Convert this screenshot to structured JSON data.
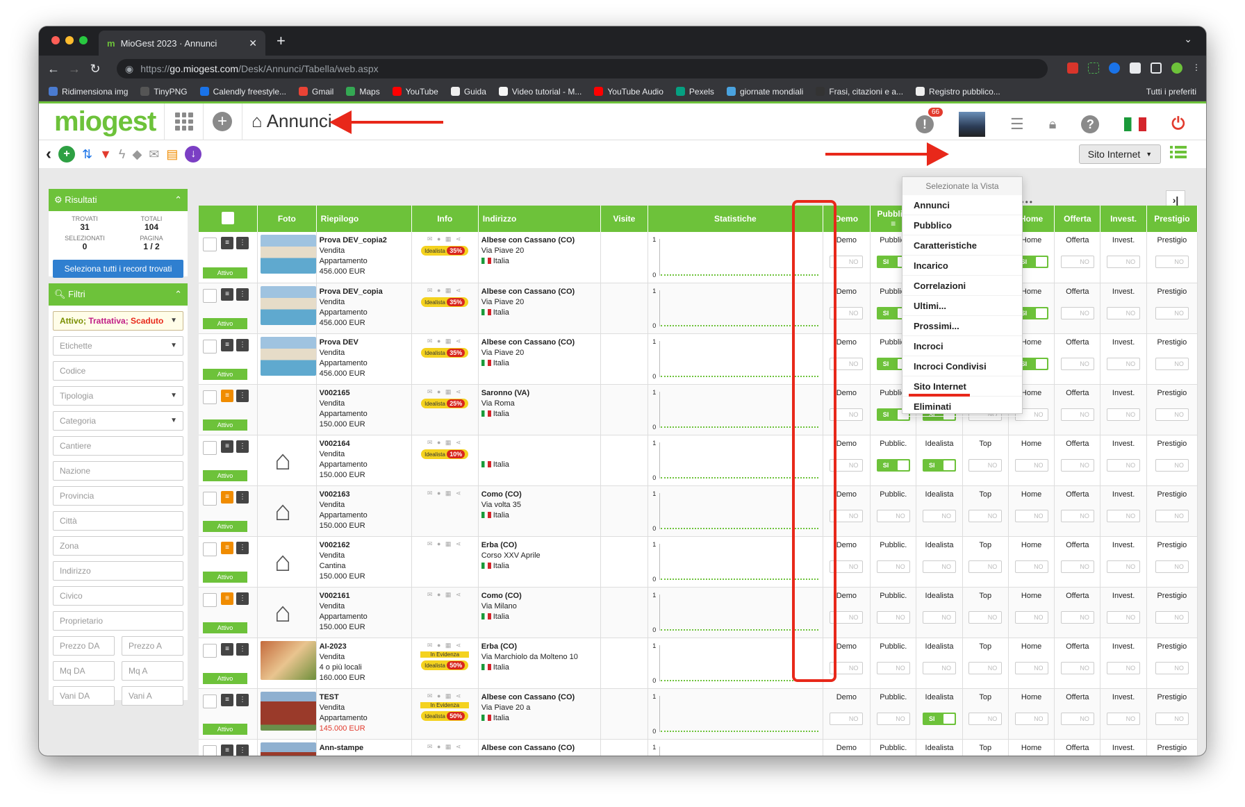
{
  "browser": {
    "tab_title": "MioGest 2023 · Annunci",
    "url_scheme": "https://",
    "url_host": "go.miogest.com",
    "url_path": "/Desk/Annunci/Tabella/web.aspx",
    "bookmarks": [
      "Ridimensiona img",
      "TinyPNG",
      "Calendly freestyle...",
      "Gmail",
      "Maps",
      "YouTube",
      "Guida",
      "Video tutorial - M...",
      "YouTube Audio",
      "Pexels",
      "giornate mondiali",
      "Frasi, citazioni e a...",
      "Registro pubblico..."
    ],
    "bookmarks_all": "Tutti i preferiti"
  },
  "app": {
    "logo": "miogest",
    "page_title": "Annunci",
    "notif_count": "66",
    "view_button": "Sito Internet"
  },
  "results": {
    "title": "Risultati",
    "trovati_label": "TROVATI",
    "trovati": "31",
    "totali_label": "TOTALI",
    "totali": "104",
    "selezionati_label": "SELEZIONATI",
    "selezionati": "0",
    "pagina_label": "PAGINA",
    "pagina": "1 / 2",
    "select_all": "Seleziona tutti i record trovati"
  },
  "filters": {
    "title": "Filtri",
    "status": "Attivo; Trattativa; Scaduto",
    "status_parts": [
      "Attivo;",
      "Trattativa;",
      "Scaduto"
    ],
    "fields": [
      "Etichette",
      "Codice",
      "Tipologia",
      "Categoria",
      "Cantiere",
      "Nazione",
      "Provincia",
      "Città",
      "Zona",
      "Indirizzo",
      "Civico",
      "Proprietario"
    ],
    "pairs": [
      [
        "Prezzo DA",
        "Prezzo A"
      ],
      [
        "Mq DA",
        "Mq A"
      ],
      [
        "Vani DA",
        "Vani A"
      ]
    ]
  },
  "table": {
    "headers": [
      "Foto",
      "Riepilogo",
      "Info",
      "Indirizzo",
      "Visite",
      "Statistiche",
      "Demo",
      "Pubblic.",
      "Idealista",
      "Top",
      "Home",
      "Offerta",
      "Invest.",
      "Prestigio"
    ],
    "cell_labels": [
      "Demo",
      "Pubblic.",
      "Idealista",
      "Top",
      "Home",
      "Offerta",
      "Invest.",
      "Prestigio"
    ],
    "off_text": "NO",
    "on_text": "SI",
    "status_text": "Attivo",
    "rows": [
      {
        "code": "Prova DEV_copia2",
        "l2": "Vendita",
        "l3": "Appartamento",
        "price": "456.000 EUR",
        "photo": "pool",
        "idealista": "Idealista",
        "pct": "35%",
        "evidenza": "",
        "city": "Albese con Cassano (CO)",
        "street": "Via Piave 20",
        "country": "Italia",
        "toggles": [
          0,
          1,
          0,
          0,
          1,
          0,
          0,
          0
        ]
      },
      {
        "code": "Prova DEV_copia",
        "l2": "Vendita",
        "l3": "Appartamento",
        "price": "456.000 EUR",
        "photo": "pool",
        "idealista": "Idealista",
        "pct": "35%",
        "evidenza": "",
        "city": "Albese con Cassano (CO)",
        "street": "Via Piave 20",
        "country": "Italia",
        "toggles": [
          0,
          1,
          1,
          0,
          1,
          0,
          0,
          0
        ]
      },
      {
        "code": "Prova DEV",
        "l2": "Vendita",
        "l3": "Appartamento",
        "price": "456.000 EUR",
        "photo": "pool",
        "idealista": "Idealista",
        "pct": "35%",
        "evidenza": "",
        "city": "Albese con Cassano (CO)",
        "street": "Via Piave 20",
        "country": "Italia",
        "toggles": [
          0,
          1,
          1,
          0,
          1,
          0,
          0,
          0
        ]
      },
      {
        "code": "V002165",
        "l2": "Vendita",
        "l3": "Appartamento",
        "price": "150.000 EUR",
        "photo": "none",
        "idealista": "Idealista",
        "pct": "25%",
        "evidenza": "",
        "city": "Saronno (VA)",
        "street": "Via Roma",
        "country": "Italia",
        "toggles": [
          0,
          1,
          1,
          0,
          0,
          0,
          0,
          0
        ]
      },
      {
        "code": "V002164",
        "l2": "Vendita",
        "l3": "Appartamento",
        "price": "150.000 EUR",
        "photo": "house",
        "idealista": "Idealista",
        "pct": "10%",
        "evidenza": "",
        "city": "",
        "street": "",
        "country": "Italia",
        "toggles": [
          0,
          1,
          1,
          0,
          0,
          0,
          0,
          0
        ]
      },
      {
        "code": "V002163",
        "l2": "Vendita",
        "l3": "Appartamento",
        "price": "150.000 EUR",
        "photo": "house",
        "idealista": "",
        "pct": "",
        "evidenza": "",
        "city": "Como (CO)",
        "street": "Via volta 35",
        "country": "Italia",
        "toggles": [
          0,
          0,
          0,
          0,
          0,
          0,
          0,
          0
        ]
      },
      {
        "code": "V002162",
        "l2": "Vendita",
        "l3": "Cantina",
        "price": "150.000 EUR",
        "photo": "house",
        "idealista": "",
        "pct": "",
        "evidenza": "",
        "city": "Erba (CO)",
        "street": "Corso XXV Aprile",
        "country": "Italia",
        "toggles": [
          0,
          0,
          0,
          0,
          0,
          0,
          0,
          0
        ]
      },
      {
        "code": "V002161",
        "l2": "Vendita",
        "l3": "Appartamento",
        "price": "150.000 EUR",
        "photo": "house",
        "idealista": "",
        "pct": "",
        "evidenza": "",
        "city": "Como (CO)",
        "street": "Via Milano",
        "country": "Italia",
        "toggles": [
          0,
          0,
          0,
          0,
          0,
          0,
          0,
          0
        ]
      },
      {
        "code": "AI-2023",
        "l2": "Vendita",
        "l3": "4 o più locali",
        "price": "160.000 EUR",
        "photo": "villa",
        "idealista": "Idealista",
        "pct": "50%",
        "evidenza": "In Evidenza",
        "city": "Erba (CO)",
        "street": "Via Marchiolo da Molteno 10",
        "country": "Italia",
        "toggles": [
          0,
          0,
          0,
          0,
          0,
          0,
          0,
          0
        ]
      },
      {
        "code": "TEST",
        "l2": "Vendita",
        "l3": "Appartamento",
        "price": "145.000 EUR",
        "photo": "brick",
        "idealista": "Idealista",
        "pct": "50%",
        "evidenza": "In Evidenza",
        "city": "Albese con Cassano (CO)",
        "street": "Via Piave 20 a",
        "country": "Italia",
        "toggles": [
          0,
          0,
          1,
          0,
          0,
          0,
          0,
          0
        ]
      },
      {
        "code": "Ann-stampe",
        "l2": "",
        "l3": "",
        "price": "",
        "photo": "brick",
        "idealista": "",
        "pct": "",
        "evidenza": "",
        "city": "Albese con Cassano (CO)",
        "street": "",
        "country": "",
        "toggles": [
          0,
          0,
          0,
          0,
          0,
          0,
          0,
          0
        ]
      }
    ]
  },
  "dropdown": {
    "header": "Selezionate la Vista",
    "items": [
      "Annunci",
      "Pubblico",
      "Caratteristiche",
      "Incarico",
      "Correlazioni",
      "Ultimi...",
      "Prossimi...",
      "Incroci",
      "Incroci Condivisi",
      "Sito Internet",
      "Eliminati"
    ]
  },
  "colors": {
    "green": "#6dc23a",
    "red_annotation": "#e8281a",
    "blue_button": "#2f7fd0"
  }
}
